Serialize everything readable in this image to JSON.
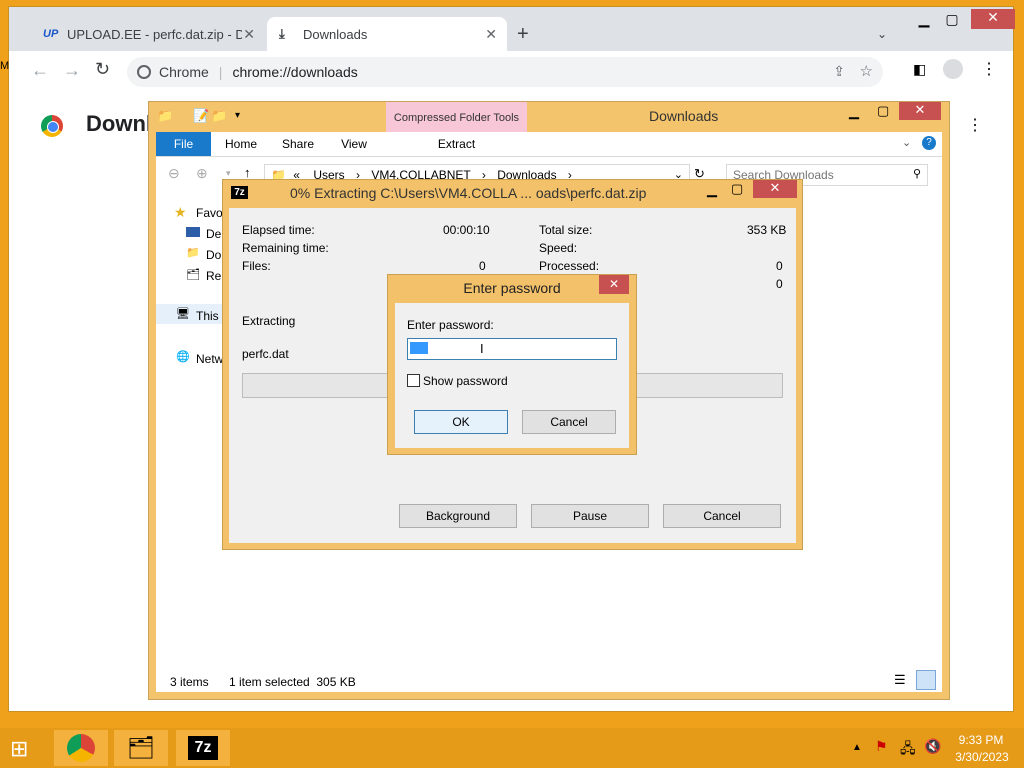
{
  "browser": {
    "tabs": [
      {
        "icon": "UP",
        "title": "UPLOAD.EE - perfc.dat.zip - Dow"
      },
      {
        "icon": "download-icon",
        "title": "Downloads"
      }
    ],
    "new_tab": "+",
    "omnibox": {
      "site": "Chrome",
      "url": "chrome://downloads"
    },
    "page_title": "Downl",
    "side_letter": "M"
  },
  "explorer": {
    "title": "Downloads",
    "contextual_tab": "Compressed Folder Tools",
    "ribbon_tabs": [
      "File",
      "Home",
      "Share",
      "View"
    ],
    "extract_tab": "Extract",
    "breadcrumb": [
      "«",
      "Users",
      "VM4.COLLABNET",
      "Downloads"
    ],
    "search_placeholder": "Search Downloads",
    "nav": {
      "favorites": "Favo",
      "desktop": "De",
      "downloads": "Do",
      "recent": "Re",
      "this_pc": "This",
      "network": "Netw"
    },
    "status": {
      "items": "3 items",
      "selected": "1 item selected  305 KB"
    }
  },
  "sevenzip": {
    "logo": "7z",
    "title": "0% Extracting C:\\Users\\VM4.COLLA ... oads\\perfc.dat.zip",
    "elapsed_label": "Elapsed time:",
    "elapsed_value": "00:00:10",
    "remaining_label": "Remaining time:",
    "files_label": "Files:",
    "files_value": "0",
    "total_label": "Total size:",
    "total_value": "353 KB",
    "speed_label": "Speed:",
    "processed_label": "Processed:",
    "processed_value": "0",
    "row4_value": "0",
    "extracting_label": "Extracting",
    "current_file": "perfc.dat",
    "progress": 0,
    "buttons": {
      "background": "Background",
      "pause": "Pause",
      "cancel": "Cancel"
    }
  },
  "password_dialog": {
    "title": "Enter password",
    "label": "Enter password:",
    "value": "",
    "show_password": "Show password",
    "ok": "OK",
    "cancel": "Cancel"
  },
  "taskbar": {
    "time": "9:33 PM",
    "date": "3/30/2023",
    "apps": [
      "chrome-icon",
      "file-explorer-icon",
      "7zip-icon"
    ]
  }
}
